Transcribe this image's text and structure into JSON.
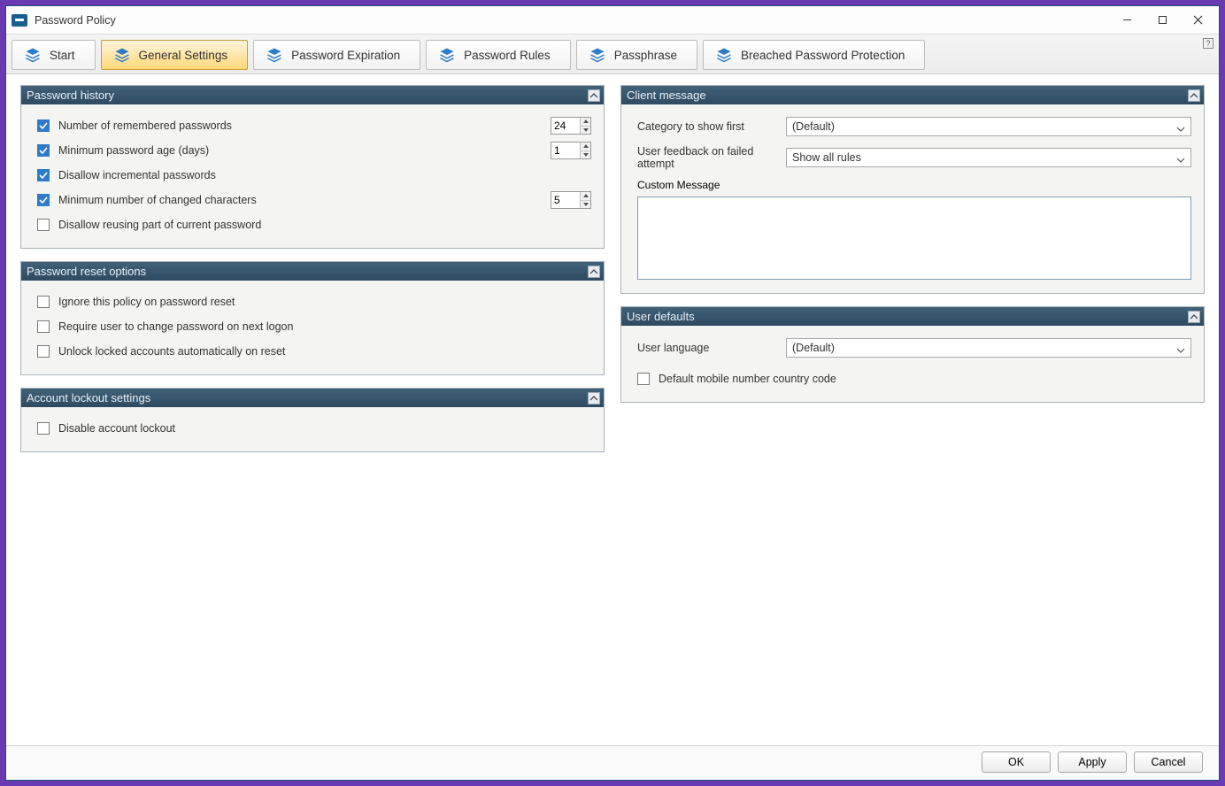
{
  "window": {
    "title": "Password Policy"
  },
  "tabs": [
    {
      "label": "Start"
    },
    {
      "label": "General Settings"
    },
    {
      "label": "Password Expiration"
    },
    {
      "label": "Password Rules"
    },
    {
      "label": "Passphrase"
    },
    {
      "label": "Breached Password Protection"
    }
  ],
  "panels": {
    "history": {
      "title": "Password history",
      "items": {
        "remembered": {
          "label": "Number of remembered passwords",
          "checked": true,
          "value": "24"
        },
        "minAge": {
          "label": "Minimum password age (days)",
          "checked": true,
          "value": "1"
        },
        "disallowIncremental": {
          "label": "Disallow incremental passwords",
          "checked": true
        },
        "minChanged": {
          "label": "Minimum number of changed characters",
          "checked": true,
          "value": "5"
        },
        "disallowReuse": {
          "label": "Disallow reusing part of current password",
          "checked": false
        }
      }
    },
    "reset": {
      "title": "Password reset options",
      "items": {
        "ignore": {
          "label": "Ignore this policy on password reset",
          "checked": false
        },
        "requireChange": {
          "label": "Require user to change password on next logon",
          "checked": false
        },
        "unlock": {
          "label": "Unlock locked accounts automatically on reset",
          "checked": false
        }
      }
    },
    "lockout": {
      "title": "Account lockout settings",
      "items": {
        "disable": {
          "label": "Disable account lockout",
          "checked": false
        }
      }
    },
    "client": {
      "title": "Client message",
      "categoryLabel": "Category to show first",
      "categoryValue": "(Default)",
      "feedbackLabel": "User feedback on failed attempt",
      "feedbackValue": "Show all rules",
      "customLabel": "Custom Message",
      "customValue": ""
    },
    "defaults": {
      "title": "User defaults",
      "langLabel": "User language",
      "langValue": "(Default)",
      "mobile": {
        "label": "Default mobile number country code",
        "checked": false
      }
    }
  },
  "footer": {
    "ok": "OK",
    "apply": "Apply",
    "cancel": "Cancel"
  }
}
